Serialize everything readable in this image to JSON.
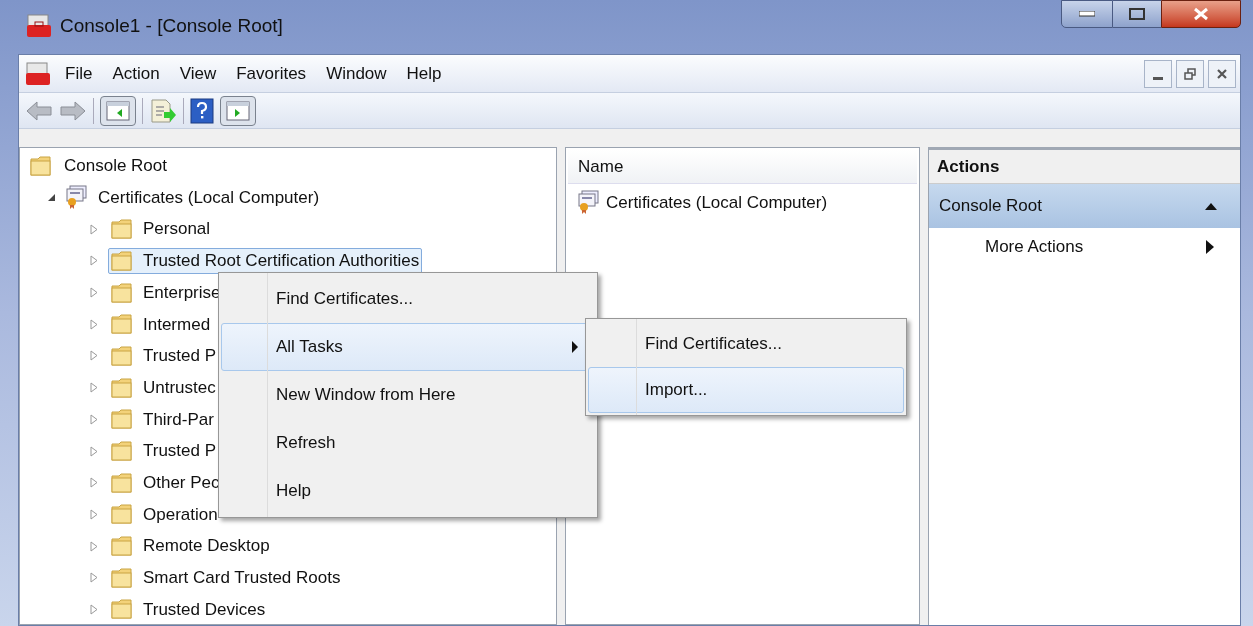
{
  "window": {
    "title": "Console1 - [Console Root]"
  },
  "menu_bar": [
    "File",
    "Action",
    "View",
    "Favorites",
    "Window",
    "Help"
  ],
  "tree": {
    "label": "Console Root",
    "children": [
      {
        "label": "Certificates (Local Computer)",
        "expanded": true,
        "selected": false,
        "children": [
          {
            "label": "Personal",
            "expanded": false,
            "selected": false
          },
          {
            "label": "Trusted Root Certification Authorities",
            "expanded": false,
            "selected": true
          },
          {
            "label": "Enterprise",
            "expanded": false,
            "selected": false
          },
          {
            "label": "Intermed",
            "expanded": false,
            "selected": false
          },
          {
            "label": "Trusted P",
            "expanded": false,
            "selected": false
          },
          {
            "label": "Untrustec",
            "expanded": false,
            "selected": false
          },
          {
            "label": "Third-Par",
            "expanded": false,
            "selected": false
          },
          {
            "label": "Trusted P",
            "expanded": false,
            "selected": false
          },
          {
            "label": "Other Pec",
            "expanded": false,
            "selected": false
          },
          {
            "label": "Operation",
            "expanded": false,
            "selected": false
          },
          {
            "label": "Remote Desktop",
            "expanded": false,
            "selected": false
          },
          {
            "label": "Smart Card Trusted Roots",
            "expanded": false,
            "selected": false
          },
          {
            "label": "Trusted Devices",
            "expanded": false,
            "selected": false
          }
        ]
      }
    ]
  },
  "list": {
    "columns": [
      "Name"
    ],
    "rows": [
      "Certificates (Local Computer)"
    ]
  },
  "actions": {
    "header": "Actions",
    "section": {
      "title": "Console Root",
      "expanded": true
    },
    "items": [
      {
        "label": "More Actions"
      }
    ]
  },
  "context_menu": {
    "items": [
      {
        "label": "Find Certificates...",
        "selected": false,
        "submenu": false
      },
      {
        "label": "All Tasks",
        "selected": true,
        "submenu": true
      },
      {
        "label": "New Window from Here",
        "selected": false,
        "submenu": false
      },
      {
        "label": "Refresh",
        "selected": false,
        "submenu": false
      },
      {
        "label": "Help",
        "selected": false,
        "submenu": false
      }
    ]
  },
  "submenu": {
    "items": [
      {
        "label": "Find Certificates...",
        "selected": false
      },
      {
        "label": "Import...",
        "selected": true
      }
    ]
  }
}
